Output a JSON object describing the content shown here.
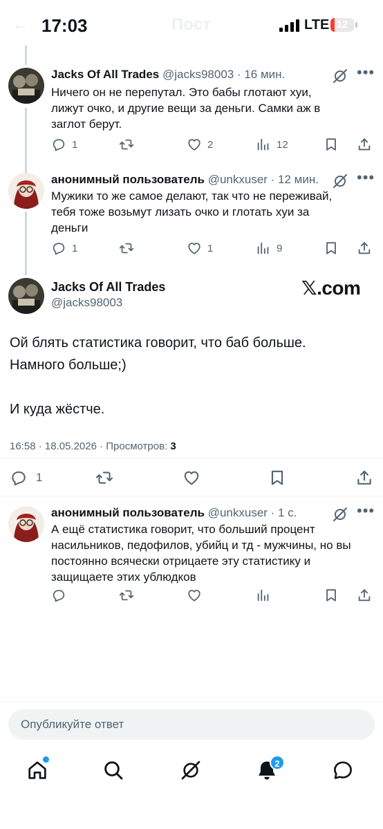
{
  "status_bar": {
    "time": "17:03",
    "network": "LTE",
    "battery": "12",
    "battery_level": 0.12
  },
  "ghost_header": {
    "back": "←",
    "title": "Пост"
  },
  "tweets": [
    {
      "name": "Jacks Of All Trades",
      "handle": "@jacks98003 · 16 мин.",
      "text": "Ничего он не перепутал. Это бабы глотают хуи,\nлижут очко, и другие вещи за деньги.  Самки аж в\nзаглот берут.",
      "replies": "1",
      "likes": "2",
      "views": "12"
    },
    {
      "name": "анонимный пользователь",
      "handle": "@unkxuser · 12 мин.",
      "text": "Мужики то же самое делают, так что не переживай,\nтебя тоже возьмут лизать очко и глотать хуи за\nденьги",
      "replies": "1",
      "likes": "1",
      "views": "9"
    }
  ],
  "main": {
    "name": "Jacks Of All Trades",
    "handle": "@jacks98003",
    "brand": ".com",
    "brand_glyph": "𝕏",
    "text": "Ой блять статистика говорит, что баб больше.\nНамного больше;)\n\nИ куда жёстче.",
    "meta_prefix": "16:58 · 18.05.2026 · Просмотров: ",
    "views": "3",
    "replies": "1"
  },
  "reply": {
    "name": "анонимный пользователь",
    "handle": "@unkxuser · 1 с.",
    "text": "А ещё статистика говорит, что больший процент\nнасильников, педофилов, убийц и тд - мужчины, но вы\nпостоянно всячески отрицаете эту статистику и\nзащищаете этих ублюдков"
  },
  "composer": {
    "placeholder": "Опубликуйте ответ"
  },
  "nav": {
    "notifications_badge": "2"
  },
  "colors": {
    "accent": "#1d9bf0",
    "muted": "#536471",
    "battery_low": "#ff3b30"
  },
  "icons": [
    "signal-icon",
    "grok-icon",
    "more-icon",
    "reply-icon",
    "retweet-icon",
    "like-icon",
    "views-icon",
    "bookmark-icon",
    "share-icon",
    "home-icon",
    "search-icon",
    "notifications-icon",
    "messages-icon"
  ]
}
